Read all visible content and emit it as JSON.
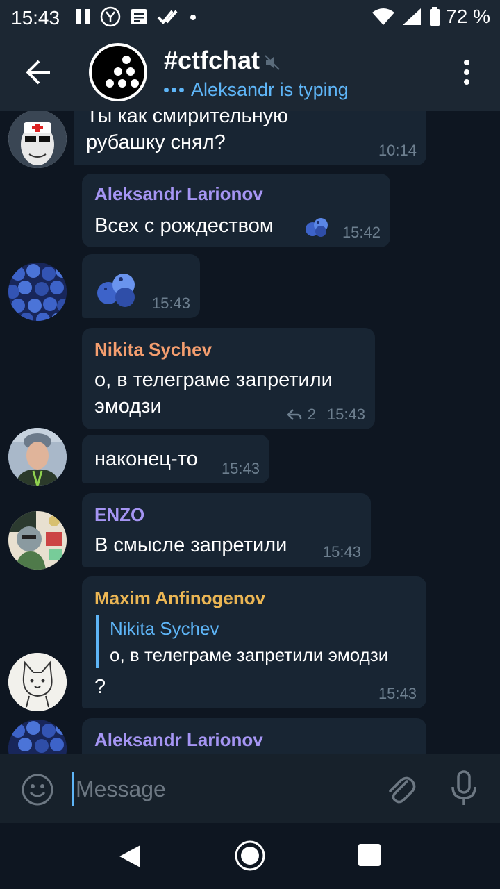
{
  "status_bar": {
    "time": "15:43",
    "battery_pct": "72 %"
  },
  "header": {
    "title": "#ctfchat",
    "subtitle": "Aleksandr is typing"
  },
  "messages": [
    {
      "sender": "",
      "text_lines": [
        "Ты как смирительную",
        "рубашку снял?"
      ],
      "time": "10:14"
    },
    {
      "sender": "Aleksandr Larionov",
      "sender_color": "#a595f3",
      "text": "Всех с рождеством",
      "time": "15:42"
    },
    {
      "sender": "",
      "emoji": "blueberries",
      "time": "15:43"
    },
    {
      "sender": "Nikita Sychev",
      "sender_color": "#f49e6f",
      "text_lines": [
        "о, в телеграме запретили",
        "эмодзи"
      ],
      "replies": "2",
      "time": "15:43"
    },
    {
      "sender": "",
      "text": "наконец-то",
      "time": "15:43"
    },
    {
      "sender": "ENZO",
      "sender_color": "#a595f3",
      "text": "В смысле запретили",
      "time": "15:43"
    },
    {
      "sender": "Maxim Anfinogenov",
      "sender_color": "#ebb654",
      "quote_sender": "Nikita Sychev",
      "quote_text": "о, в телеграме запретили эмодзи",
      "text": "?",
      "time": "15:43"
    },
    {
      "sender": "Aleksandr Larionov",
      "sender_color": "#a595f3"
    }
  ],
  "input": {
    "placeholder": "Message"
  },
  "colors": {
    "background": "#0e1621",
    "bubble": "#182533",
    "header": "#1c2733",
    "accent": "#5eb5f7"
  }
}
